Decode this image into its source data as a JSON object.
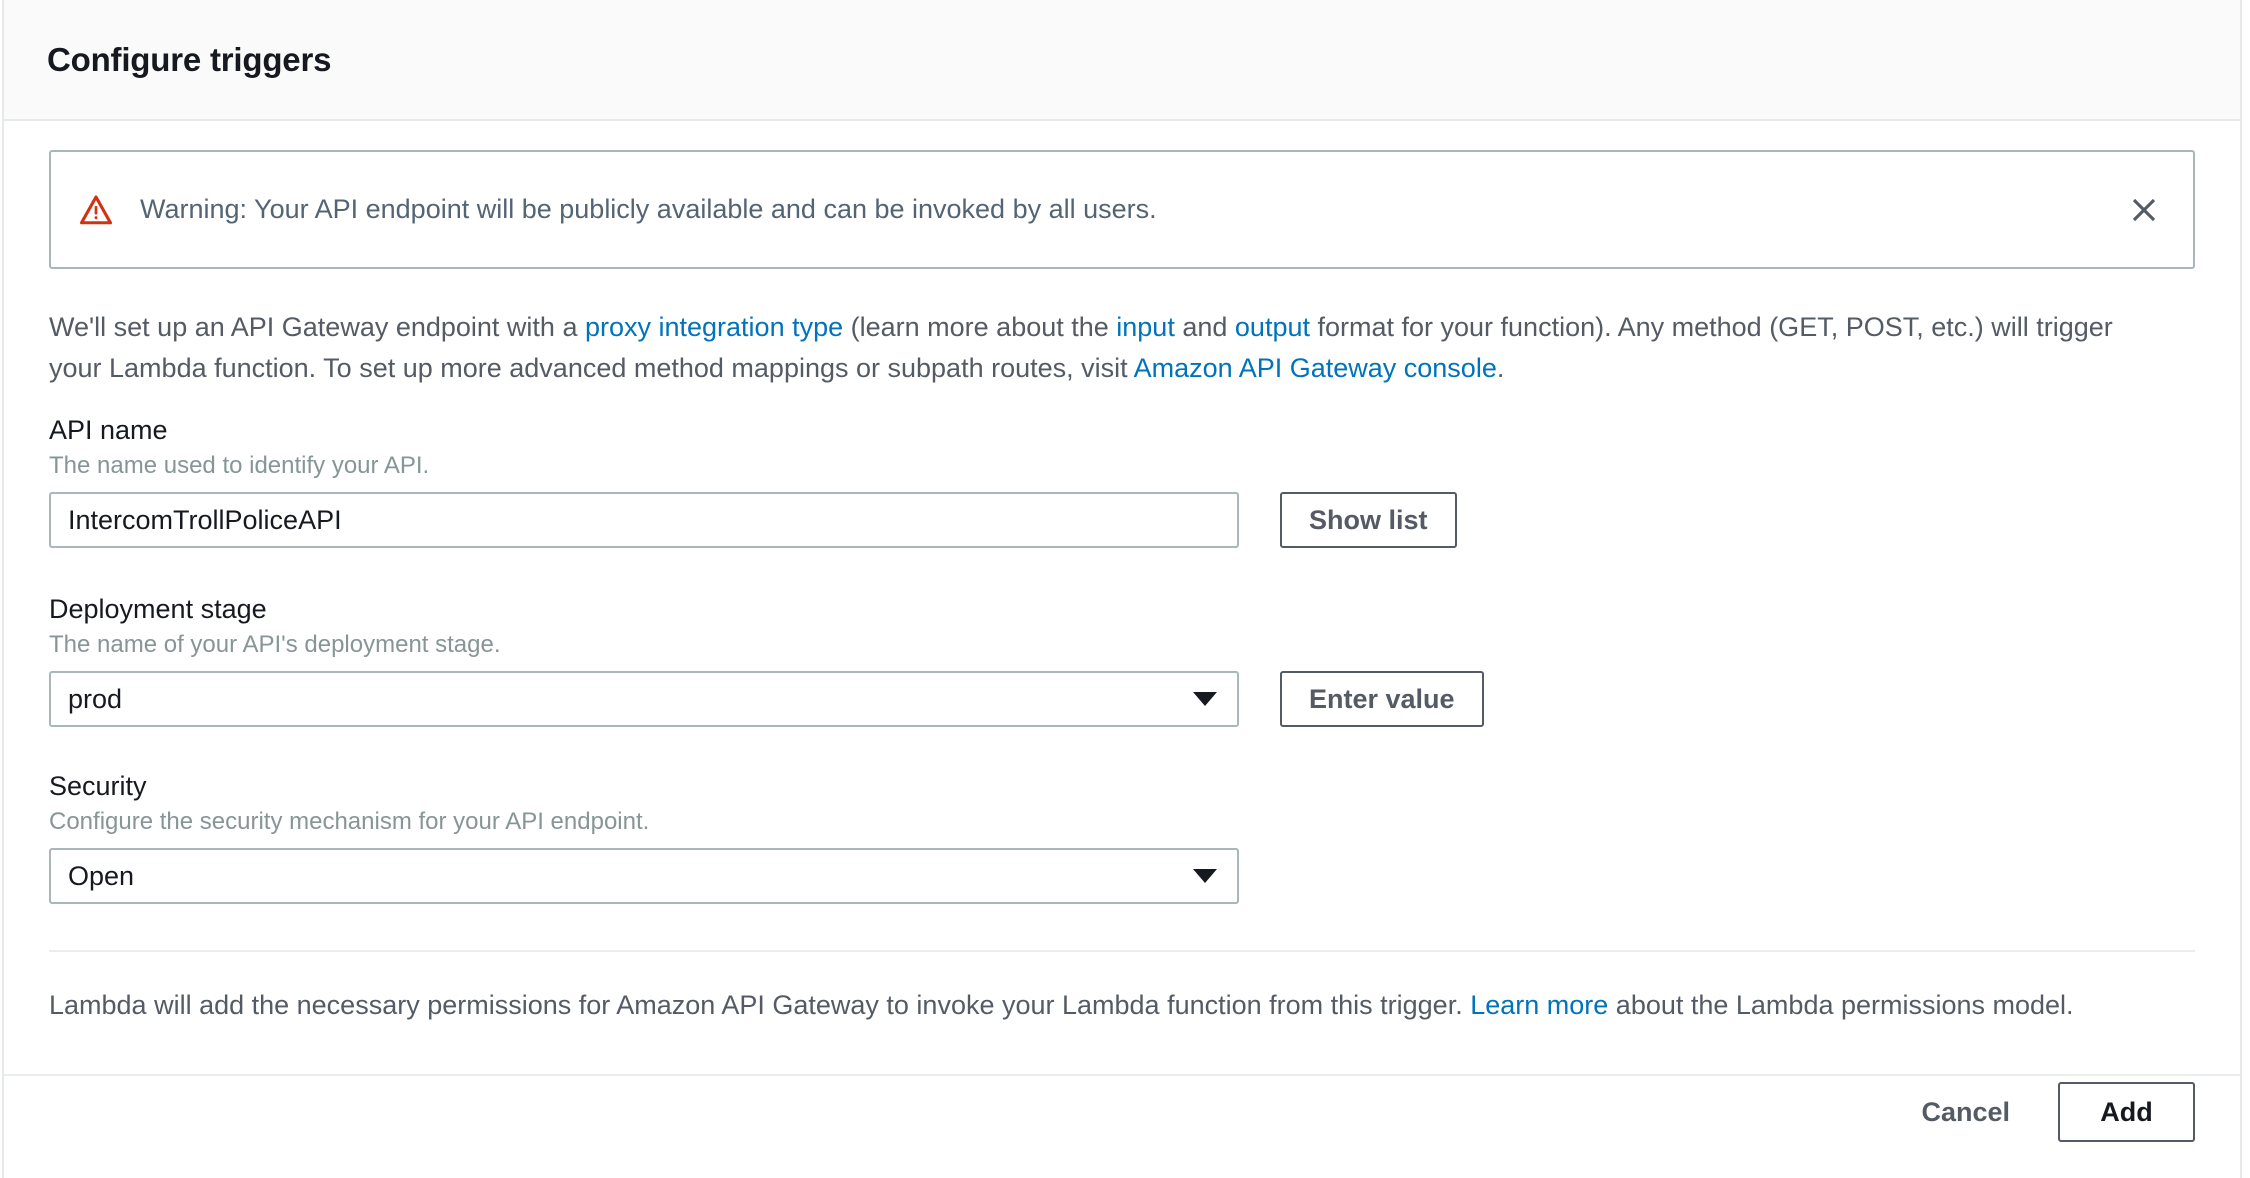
{
  "header": {
    "title": "Configure triggers"
  },
  "alert": {
    "icon": "warning-triangle-icon",
    "message": "Warning: Your API endpoint will be publicly available and can be invoked by all users.",
    "close_icon": "close-icon",
    "border_color": "#aab7b8",
    "icon_color": "#d13212"
  },
  "intro": {
    "part1": "We'll set up an API Gateway endpoint with a ",
    "link1": "proxy integration type",
    "part2": " (learn more about the ",
    "link2": "input",
    "part3": " and ",
    "link3": "output",
    "part4": " format for your function). Any method (GET, POST, etc.) will trigger your Lambda function. To set up more advanced method mappings or subpath routes, visit ",
    "link4": "Amazon API Gateway console",
    "part5": "."
  },
  "form": {
    "api_name": {
      "label": "API name",
      "description": "The name used to identify your API.",
      "value": "IntercomTrollPoliceAPI",
      "placeholder": "",
      "button": "Show list"
    },
    "deployment_stage": {
      "label": "Deployment stage",
      "description": "The name of your API's deployment stage.",
      "value": "prod",
      "options": [
        "prod"
      ],
      "button": "Enter value",
      "arrow_icon": "chevron-down-icon"
    },
    "security": {
      "label": "Security",
      "description": "Configure the security mechanism for your API endpoint.",
      "value": "Open",
      "options": [
        "Open"
      ],
      "arrow_icon": "chevron-down-icon"
    }
  },
  "note": {
    "part1": "Lambda will add the necessary permissions for Amazon API Gateway to invoke your Lambda function from this trigger. ",
    "link": "Learn more",
    "part2": " about the Lambda permissions model."
  },
  "actions": {
    "cancel": "Cancel",
    "add": "Add"
  },
  "colors": {
    "link": "#0073bb",
    "text": "#545b64",
    "heading": "#16191f",
    "muted": "#879596",
    "border": "#aab7b8",
    "divider": "#eaeded",
    "header_bg": "#fafafa"
  }
}
